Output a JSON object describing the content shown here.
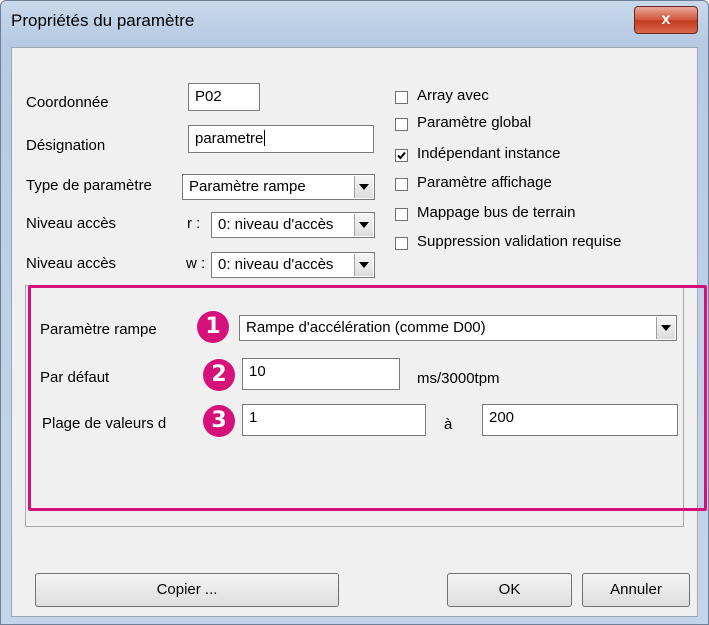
{
  "window": {
    "title": "Propriétés du paramètre",
    "close_label": "x"
  },
  "fields": {
    "coordonnee_label": "Coordonnée",
    "coordonnee_value": "P02",
    "designation_label": "Désignation",
    "designation_value": "parametre",
    "type_label": "Type de paramètre",
    "type_value": "Paramètre rampe",
    "niveau_r_label": "Niveau accès",
    "niveau_r_suffix": "r :",
    "niveau_r_value": "0: niveau d'accès",
    "niveau_w_label": "Niveau accès",
    "niveau_w_suffix": "w :",
    "niveau_w_value": "0: niveau d'accès"
  },
  "checkboxes": [
    {
      "label": "Array avec",
      "checked": false
    },
    {
      "label": "Paramètre global",
      "checked": false
    },
    {
      "label": "Indépendant instance",
      "checked": true
    },
    {
      "label": "Paramètre affichage",
      "checked": false
    },
    {
      "label": "Mappage bus de terrain",
      "checked": false
    },
    {
      "label": "Suppression validation requise",
      "checked": false
    }
  ],
  "ramp": {
    "param_label": "Paramètre rampe",
    "param_value": "Rampe d'accélération (comme D00)",
    "default_label": "Par défaut",
    "default_value": "10",
    "default_unit": "ms/3000tpm",
    "range_label": "Plage de  valeurs d",
    "range_min": "1",
    "range_sep": "à",
    "range_max": "200"
  },
  "badges": [
    "1",
    "2",
    "3"
  ],
  "buttons": {
    "copy": "Copier ...",
    "ok": "OK",
    "cancel": "Annuler"
  },
  "colors": {
    "highlight": "#d6127a",
    "close": "#c2391f"
  }
}
